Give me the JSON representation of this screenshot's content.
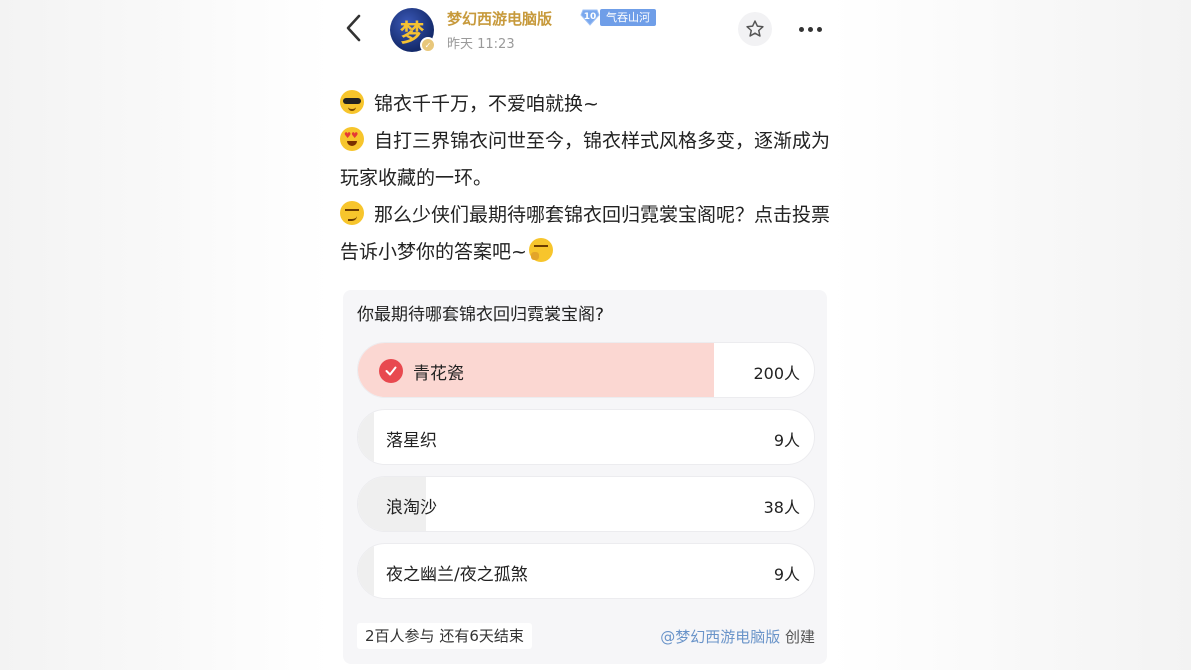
{
  "header": {
    "avatar_char": "梦",
    "author_name": "梦幻西游电脑版",
    "level_number": "10",
    "level_title": "气吞山河",
    "post_time": "昨天 11:23"
  },
  "content": {
    "line1": "锦衣千千万，不爱咱就换~",
    "line2": "自打三界锦衣问世至今，锦衣样式风格多变，逐渐成为玩家收藏的一环。",
    "line3": "那么少侠们最期待哪套锦衣回归霓裳宝阁呢？点击投票告诉小梦你的答案吧~",
    "emojis": [
      "sunglasses-emoji",
      "heart-eyes-emoji",
      "smirk-emoji",
      "thinking-emoji"
    ]
  },
  "poll": {
    "question": "你最期待哪套锦衣回归霓裳宝阁?",
    "options": [
      {
        "label": "青花瓷",
        "count": "200人",
        "share": 0.78,
        "selected": true
      },
      {
        "label": "落星织",
        "count": "9人",
        "share": 0.035,
        "selected": false
      },
      {
        "label": "浪淘沙",
        "count": "38人",
        "share": 0.15,
        "selected": false
      },
      {
        "label": "夜之幽兰/夜之孤煞",
        "count": "9人",
        "share": 0.035,
        "selected": false
      }
    ],
    "participants": "2百人参与",
    "remaining": "还有6天结束",
    "creator_link": "@梦幻西游电脑版",
    "creator_suffix": "创建"
  },
  "colors": {
    "author": "#c79a3c",
    "selected_fill": "#fbd7d2",
    "check": "#e8494f",
    "link": "#6a94c9"
  }
}
